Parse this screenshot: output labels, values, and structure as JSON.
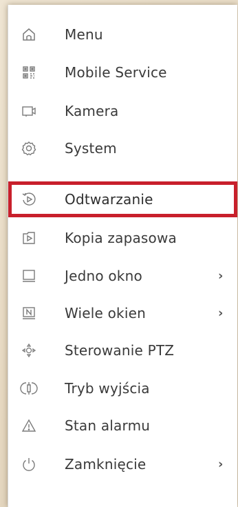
{
  "menu": {
    "items": [
      {
        "label": "Menu",
        "icon": "home-icon",
        "has_submenu": false,
        "selected": false
      },
      {
        "label": "Mobile Service",
        "icon": "qr-code-icon",
        "has_submenu": false,
        "selected": false
      },
      {
        "label": "Kamera",
        "icon": "camera-icon",
        "has_submenu": false,
        "selected": false
      },
      {
        "label": "System",
        "icon": "gear-icon",
        "has_submenu": false,
        "selected": false
      },
      {
        "label": "Odtwarzanie",
        "icon": "playback-icon",
        "has_submenu": false,
        "selected": true
      },
      {
        "label": "Kopia zapasowa",
        "icon": "backup-play-icon",
        "has_submenu": false,
        "selected": false
      },
      {
        "label": "Jedno okno",
        "icon": "single-window-icon",
        "has_submenu": true,
        "selected": false
      },
      {
        "label": "Wiele okien",
        "icon": "multi-window-icon",
        "has_submenu": true,
        "selected": false
      },
      {
        "label": "Sterowanie PTZ",
        "icon": "ptz-icon",
        "has_submenu": false,
        "selected": false
      },
      {
        "label": "Tryb wyjścia",
        "icon": "output-mode-icon",
        "has_submenu": false,
        "selected": false
      },
      {
        "label": "Stan alarmu",
        "icon": "warning-icon",
        "has_submenu": false,
        "selected": false
      },
      {
        "label": "Zamknięcie",
        "icon": "power-icon",
        "has_submenu": true,
        "selected": false
      }
    ],
    "submenu_arrow": "›"
  },
  "colors": {
    "highlight": "#c8202b",
    "text": "#3a3a3a",
    "icon": "#7a7a7a",
    "background": "#ffffff"
  }
}
